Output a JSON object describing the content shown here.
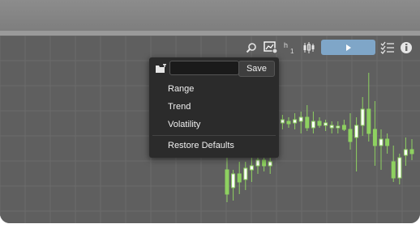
{
  "toolbar": {
    "icons": [
      "zoom-icon",
      "chart-settings-icon",
      "timeframe-icon",
      "candles-icon",
      "play-icon",
      "checklist-icon",
      "info-icon"
    ],
    "timeframe_letter": "h",
    "timeframe_number": "1"
  },
  "menu": {
    "name_placeholder": "",
    "save_label": "Save",
    "items": [
      "Range",
      "Trend",
      "Volatility"
    ],
    "restore_label": "Restore Defaults"
  },
  "colors": {
    "bull": "#8ed160",
    "bear": "#8ed160",
    "accent": "#7fa6c8",
    "menu_bg": "#2b2b2b"
  },
  "chart_data": {
    "type": "candlestick",
    "candles": [
      {
        "o": 210,
        "h": 195,
        "l": 250,
        "c": 240
      },
      {
        "o": 232,
        "h": 210,
        "l": 248,
        "c": 215
      },
      {
        "o": 215,
        "h": 200,
        "l": 240,
        "c": 225
      },
      {
        "o": 222,
        "h": 200,
        "l": 235,
        "c": 208
      },
      {
        "o": 210,
        "h": 195,
        "l": 225,
        "c": 205
      },
      {
        "o": 205,
        "h": 190,
        "l": 215,
        "c": 198
      },
      {
        "o": 198,
        "h": 190,
        "l": 212,
        "c": 205
      },
      {
        "o": 205,
        "h": 195,
        "l": 215,
        "c": 200
      },
      {
        "o": 150,
        "h": 140,
        "l": 160,
        "c": 155
      },
      {
        "o": 152,
        "h": 142,
        "l": 160,
        "c": 148
      },
      {
        "o": 150,
        "h": 145,
        "l": 158,
        "c": 153
      },
      {
        "o": 152,
        "h": 140,
        "l": 160,
        "c": 148
      },
      {
        "o": 150,
        "h": 138,
        "l": 165,
        "c": 145
      },
      {
        "o": 145,
        "h": 130,
        "l": 162,
        "c": 158
      },
      {
        "o": 158,
        "h": 138,
        "l": 165,
        "c": 150
      },
      {
        "o": 150,
        "h": 145,
        "l": 158,
        "c": 155
      },
      {
        "o": 155,
        "h": 148,
        "l": 162,
        "c": 152
      },
      {
        "o": 158,
        "h": 150,
        "l": 165,
        "c": 155
      },
      {
        "o": 158,
        "h": 150,
        "l": 165,
        "c": 156
      },
      {
        "o": 155,
        "h": 148,
        "l": 162,
        "c": 160
      },
      {
        "o": 160,
        "h": 140,
        "l": 185,
        "c": 175
      },
      {
        "o": 170,
        "h": 145,
        "l": 212,
        "c": 155
      },
      {
        "o": 155,
        "h": 120,
        "l": 168,
        "c": 135
      },
      {
        "o": 135,
        "h": 90,
        "l": 175,
        "c": 165
      },
      {
        "o": 160,
        "h": 125,
        "l": 205,
        "c": 180
      },
      {
        "o": 180,
        "h": 160,
        "l": 210,
        "c": 172
      },
      {
        "o": 172,
        "h": 165,
        "l": 190,
        "c": 180
      },
      {
        "o": 200,
        "h": 180,
        "l": 225,
        "c": 220
      },
      {
        "o": 220,
        "h": 190,
        "l": 228,
        "c": 195
      },
      {
        "o": 192,
        "h": 170,
        "l": 205,
        "c": 185
      },
      {
        "o": 185,
        "h": 172,
        "l": 198,
        "c": 190
      }
    ]
  }
}
